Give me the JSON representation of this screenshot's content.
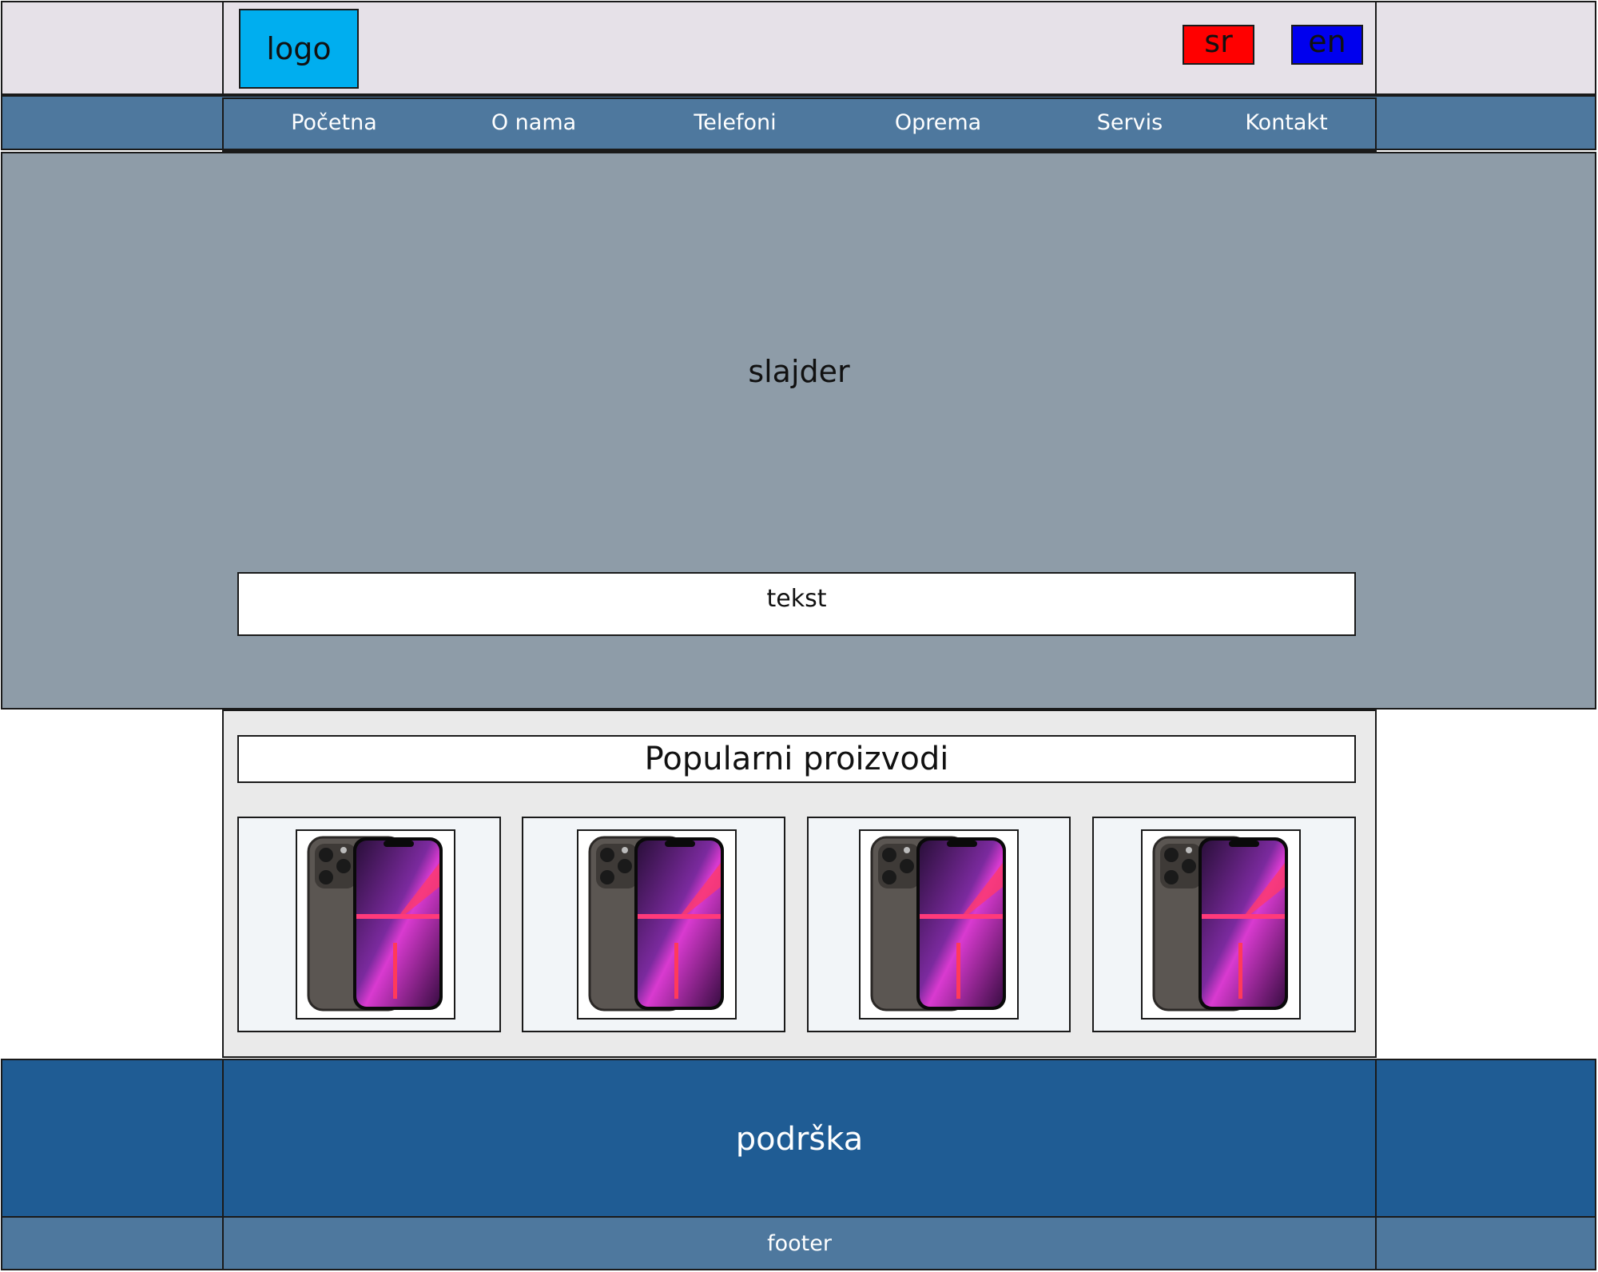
{
  "header": {
    "logo_label": "logo",
    "languages": [
      {
        "label": "sr",
        "color": "#ff0000"
      },
      {
        "label": "en",
        "color": "#0000ee"
      }
    ]
  },
  "nav": {
    "items": [
      {
        "label": "Početna"
      },
      {
        "label": "O nama"
      },
      {
        "label": "Telefoni"
      },
      {
        "label": "Oprema"
      },
      {
        "label": "Servis"
      },
      {
        "label": "Kontakt"
      }
    ]
  },
  "slider": {
    "title": "slajder",
    "caption": "tekst"
  },
  "products": {
    "title": "Popularni proizvodi",
    "items": [
      {
        "icon": "smartphone-icon"
      },
      {
        "icon": "smartphone-icon"
      },
      {
        "icon": "smartphone-icon"
      },
      {
        "icon": "smartphone-icon"
      }
    ]
  },
  "support": {
    "label": "podrška"
  },
  "footer": {
    "label": "footer"
  },
  "colors": {
    "header_bg": "#e6e1e8",
    "logo_bg": "#00aeef",
    "nav_bg": "#4e789e",
    "slider_bg": "#8e9ca8",
    "support_bg": "#1f5c94",
    "footer_bg": "#4e789e"
  }
}
